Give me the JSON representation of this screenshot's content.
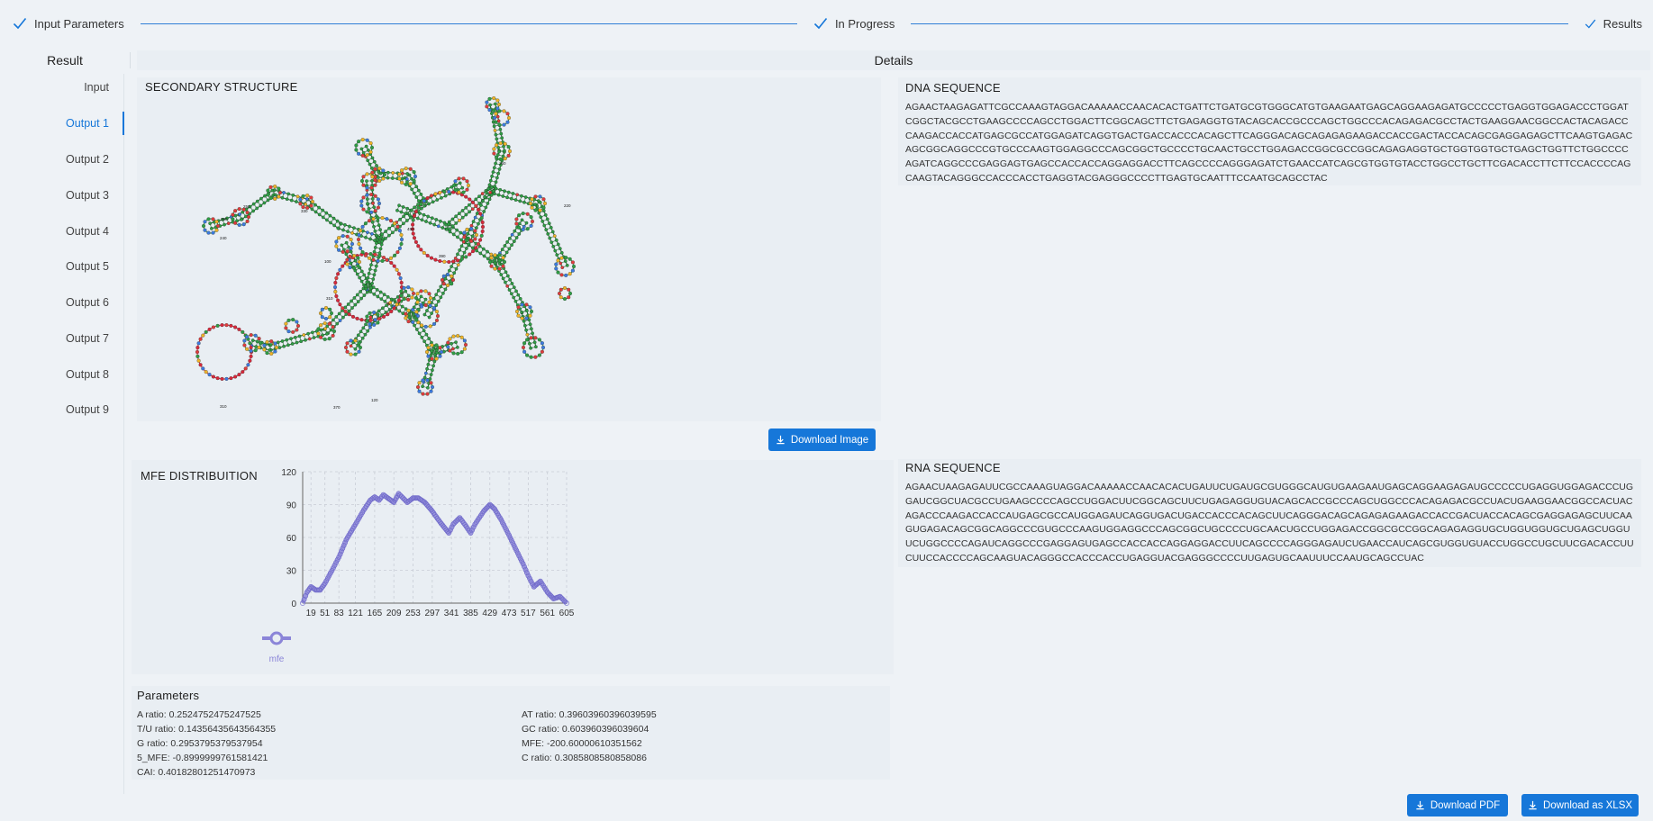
{
  "stepper": {
    "steps": [
      {
        "label": "Input Parameters"
      },
      {
        "label": "In Progress"
      },
      {
        "label": "Results"
      }
    ]
  },
  "headers": {
    "result": "Result",
    "details": "Details"
  },
  "nav": {
    "items": [
      "Input",
      "Output 1",
      "Output 2",
      "Output 3",
      "Output 4",
      "Output 5",
      "Output 6",
      "Output 7",
      "Output 8",
      "Output 9"
    ],
    "active": "Output 1"
  },
  "secondary_structure": {
    "title": "SECONDARY STRUCTURE",
    "download_label": "Download Image"
  },
  "dna": {
    "title": "DNA SEQUENCE",
    "sequence": "AGAACTAAGAGATTCGCCAAAGTAGGACAAAAACCAACACACTGATTCTGATGCGTGGGCATGTGAAGAATGAGCAGGAAGAGATGCCCCCTGAGGTGGAGACCCTGGATCGGCTACGCCTGAAGCCCCAGCCTGGACTTCGGCAGCTTCTGAGAGGTGTACAGCACCGCCCAGCTGGCCCACAGAGACGCCTACTGAAGGAACGGCCACTACAGACCCAAGACCACCATGAGCGCCATGGAGATCAGGTGACTGACCACCCACAGCTTCAGGGACAGCAGAGAGAAGACCACCGACTACCACAGCGAGGAGAGCTTCAAGTGAGACAGCGGCAGGCCCGTGCCCAAGTGGAGGCCCAGCGGCTGCCCCTGCAACTGCCTGGAGACCGGCGCCGGCAGAGAGGTGCTGGTGGTGCTGAGCTGGTTCTGGCCCCAGATCAGGCCCGAGGAGTGAGCCACCACCAGGAGGACCTTCAGCCCCAGGGAGATCTGAACCATCAGCGTGGTGTACCTGGCCTGCTTCGACACCTTCTTCCACCCCAGCAAGTACAGGGCCACCCACCTGAGGTACGAGGGCCCCTTGAGTGCAATTTCCAATGCAGCCTAC"
  },
  "rna": {
    "title": "RNA SEQUENCE",
    "sequence": "AGAACUAAGAGAUUCGCCAAAGUAGGACAAAAACCAACACACUGAUUCUGAUGCGUGGGCAUGUGAAGAAUGAGCAGGAAGAGAUGCCCCCUGAGGUGGAGACCCUGGAUCGGCUACGCCUGAAGCCCCAGCCUGGACUUCGGCAGCUUCUGAGAGGUGUACAGCACCGCCCAGCUGGCCCACAGAGACGCCUACUGAAGGAACGGCCACUACAGACCCAAGACCACCAUGAGCGCCAUGGAGAUCAGGUGACUGACCACCCACAGCUUCAGGGACAGCAGAGAGAAGACCACCGACUACCACAGCGAGGAGAGCUUCAAGUGAGACAGCGGCAGGCCCGUGCCCAAGUGGAGGCCCAGCGGCUGCCCCUGCAACUGCCUGGAGACCGGCGCCGGCAGAGAGGUGCUGGUGGUGCUGAGCUGGUUCUGGCCCCAGAUCAGGCCCGAGGAGUGAGCCACCACCAGGAGGACCUUCAGCCCCAGGGAGAUCUGAACCAUCAGCGUGGUGUACCUGGCCUGCUUCGACACCUUCUUCCACCCCAGCAAGUACAGGGCCACCCACCUGAGGUACGAGGGCCCCUUGAGUGCAAUUUCCAAUGCAGCCUAC"
  },
  "mfe": {
    "title": "MFE DISTRIBUITION",
    "legend_label": "mfe"
  },
  "chart_data": {
    "type": "line",
    "title": "MFE DISTRIBUITION",
    "x_ticks": [
      19,
      51,
      83,
      121,
      165,
      209,
      253,
      297,
      341,
      385,
      429,
      473,
      517,
      561,
      605
    ],
    "y_ticks": [
      0,
      30,
      60,
      90,
      120
    ],
    "ylim": [
      0,
      120
    ],
    "xlim": [
      0,
      605
    ],
    "grid": true,
    "legend_placement": "bottom-left",
    "series": [
      {
        "name": "mfe",
        "color": "#8b85d8",
        "points": [
          [
            0,
            0
          ],
          [
            10,
            10
          ],
          [
            19,
            15
          ],
          [
            30,
            12
          ],
          [
            40,
            12
          ],
          [
            51,
            18
          ],
          [
            70,
            32
          ],
          [
            83,
            42
          ],
          [
            100,
            58
          ],
          [
            121,
            72
          ],
          [
            140,
            85
          ],
          [
            155,
            94
          ],
          [
            165,
            97
          ],
          [
            175,
            94
          ],
          [
            185,
            99
          ],
          [
            195,
            96
          ],
          [
            209,
            92
          ],
          [
            220,
            100
          ],
          [
            230,
            96
          ],
          [
            240,
            92
          ],
          [
            253,
            96
          ],
          [
            265,
            96
          ],
          [
            280,
            92
          ],
          [
            297,
            84
          ],
          [
            315,
            74
          ],
          [
            335,
            64
          ],
          [
            345,
            72
          ],
          [
            360,
            78
          ],
          [
            375,
            70
          ],
          [
            385,
            64
          ],
          [
            395,
            72
          ],
          [
            405,
            78
          ],
          [
            415,
            84
          ],
          [
            429,
            90
          ],
          [
            440,
            86
          ],
          [
            455,
            76
          ],
          [
            473,
            62
          ],
          [
            490,
            48
          ],
          [
            505,
            36
          ],
          [
            517,
            25
          ],
          [
            530,
            15
          ],
          [
            545,
            20
          ],
          [
            561,
            10
          ],
          [
            575,
            4
          ],
          [
            590,
            6
          ],
          [
            605,
            0
          ]
        ]
      }
    ]
  },
  "parameters": {
    "title": "Parameters",
    "left": [
      "A ratio: 0.2524752475247525",
      "T/U ratio: 0.14356435643564355",
      "G ratio: 0.2953795379537954",
      "5_MFE: -0.8999999761581421",
      "CAI: 0.40182801251470973"
    ],
    "right": [
      "AT ratio: 0.39603960396039595",
      "GC ratio: 0.603960396039604",
      "MFE: -200.60000610351562",
      "C ratio: 0.3085808580858086"
    ]
  },
  "footer": {
    "pdf_label": "Download PDF",
    "xlsx_label": "Download as XLSX"
  },
  "colors": {
    "accent": "#1677d9",
    "series": "#8b85d8",
    "helix": "#1f8a3a",
    "loop_red": "#d8283a"
  }
}
